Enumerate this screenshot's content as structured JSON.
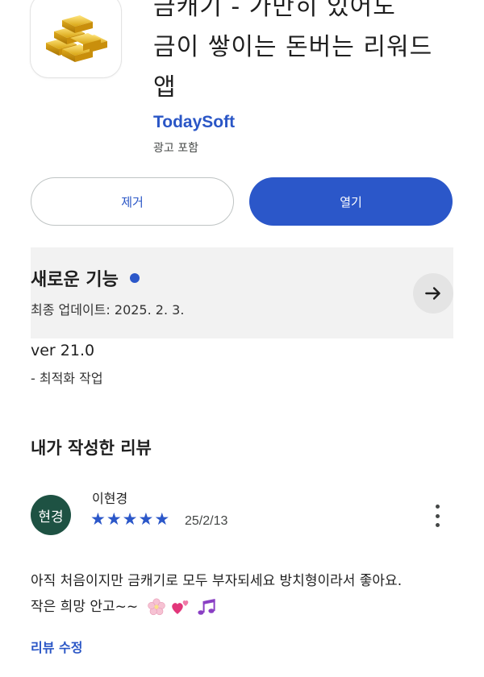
{
  "app": {
    "title_line1": "금캐기 - 가만히 있어도",
    "title_line2": "금이 쌓이는 돈버는 리워드",
    "title_line3": "앱",
    "developer": "TodaySoft",
    "ads_label": "광고 포함",
    "icon": "gold-bars-icon"
  },
  "actions": {
    "remove_label": "제거",
    "open_label": "열기"
  },
  "whats_new": {
    "title": "새로운 기능",
    "updated_prefix": "최종 업데이트: ",
    "updated_date": "2025. 2. 3.",
    "version": "ver 21.0",
    "notes": "- 최적화 작업"
  },
  "my_review": {
    "heading": "내가 작성한 리뷰",
    "avatar_text": "현경",
    "reviewer_name": "이현경",
    "rating": 5,
    "date": "25/2/13",
    "text_line1": "아직 처음이지만 금캐기로 모두 부자되세요 방치형이라서 좋아요.",
    "text_line2": "작은 희망 안고~~",
    "edit_label": "리뷰 수정"
  },
  "colors": {
    "accent": "#2b57c9",
    "avatar_bg": "#1e5243",
    "panel_bg": "#f2f2f2"
  }
}
